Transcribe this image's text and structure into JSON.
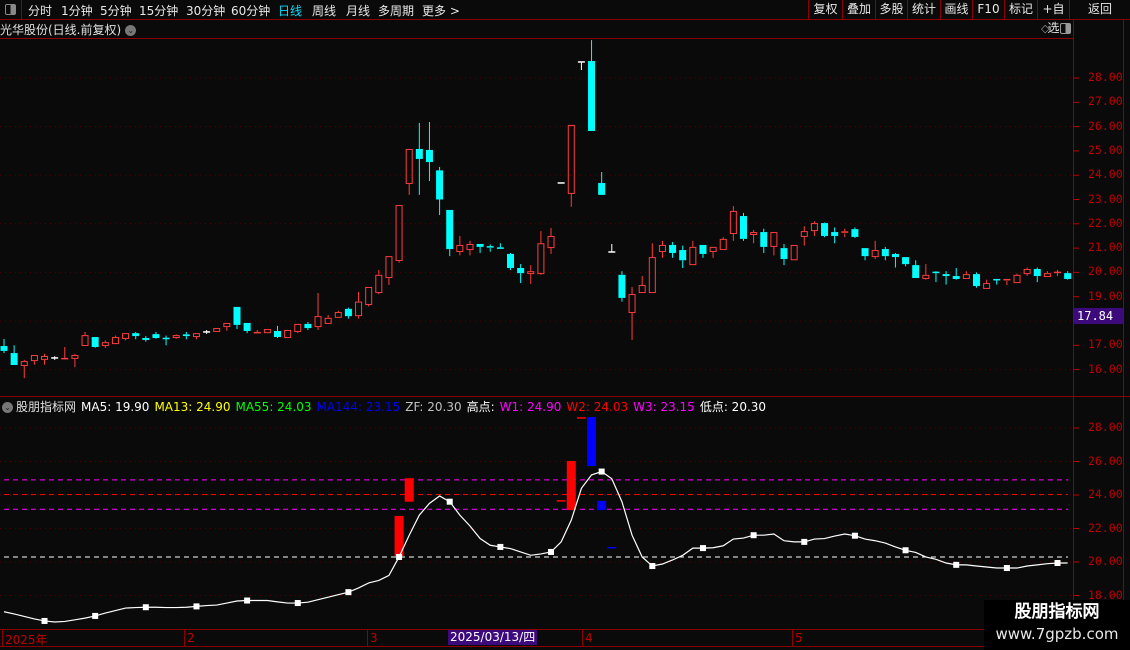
{
  "toolbar": {
    "periods": [
      "分时",
      "1分钟",
      "5分钟",
      "15分钟",
      "30分钟",
      "60分钟",
      "日线",
      "周线",
      "月线",
      "多周期",
      "更多 >"
    ],
    "active_period": "日线",
    "right_buttons": [
      "复权",
      "叠加",
      "多股",
      "统计",
      "画线",
      "F10",
      "标记",
      "+自选",
      "返回"
    ]
  },
  "chart_title": "光华股份(日线.前复权)",
  "price_axis": [
    "28.00",
    "27.00",
    "26.00",
    "25.00",
    "24.00",
    "23.00",
    "22.00",
    "21.00",
    "20.00",
    "19.00",
    "17.00",
    "16.00"
  ],
  "last_price": "17.84",
  "sub_axis": [
    "28.00",
    "26.00",
    "24.00",
    "22.00",
    "20.00",
    "18.00"
  ],
  "indicator": {
    "name": "股朋指标网",
    "items": [
      {
        "text": "MA5: 19.90",
        "color": "#ffffff"
      },
      {
        "text": "MA13: 24.90",
        "color": "#ffff00"
      },
      {
        "text": "MA55: 24.03",
        "color": "#00ff00"
      },
      {
        "text": "MA144: 23.15",
        "color": "#0000ff"
      },
      {
        "text": "ZF: 20.30",
        "color": "#c0c0c0"
      },
      {
        "text": "高点:",
        "color": "#ffffff"
      },
      {
        "text": "W1: 24.90",
        "color": "#ff00ff"
      },
      {
        "text": "W2: 24.03",
        "color": "#ff0000"
      },
      {
        "text": "W3: 23.15",
        "color": "#ff00ff"
      },
      {
        "text": "低点: 20.30",
        "color": "#ffffff"
      }
    ]
  },
  "x_axis": {
    "labels": [
      "2025年",
      "2",
      "3",
      "4",
      "5"
    ],
    "cursor_date": "2025/03/13/四"
  },
  "watermark": {
    "title": "股朋指标网",
    "url": "www.7gpzb.com"
  },
  "colors": {
    "up": "#ff3c3c",
    "down": "#00ffff",
    "doji": "#ffffff",
    "axis": "#c00000",
    "border": "#8b0000",
    "highlight": "#3c0a7a"
  },
  "chart_data": {
    "type": "candlestick",
    "ohlc_columns": [
      "open",
      "high",
      "low",
      "close"
    ],
    "candles": [
      [
        16.97,
        17.26,
        16.68,
        16.77
      ],
      [
        16.68,
        17.0,
        16.19,
        16.19
      ],
      [
        16.15,
        16.4,
        15.65,
        16.35
      ],
      [
        16.35,
        16.6,
        16.2,
        16.6
      ],
      [
        16.4,
        16.65,
        16.2,
        16.56
      ],
      [
        16.48,
        16.55,
        16.4,
        16.48
      ],
      [
        16.42,
        16.93,
        16.42,
        16.45
      ],
      [
        16.44,
        16.65,
        16.1,
        16.6
      ],
      [
        16.97,
        17.55,
        16.97,
        17.42
      ],
      [
        17.34,
        17.34,
        16.9,
        16.93
      ],
      [
        16.97,
        17.2,
        16.89,
        17.13
      ],
      [
        17.05,
        17.4,
        17.05,
        17.34
      ],
      [
        17.26,
        17.5,
        17.2,
        17.5
      ],
      [
        17.5,
        17.55,
        17.25,
        17.38
      ],
      [
        17.3,
        17.38,
        17.15,
        17.22
      ],
      [
        17.46,
        17.55,
        17.27,
        17.3
      ],
      [
        17.28,
        17.4,
        17.0,
        17.25
      ],
      [
        17.3,
        17.45,
        17.27,
        17.42
      ],
      [
        17.45,
        17.55,
        17.25,
        17.38
      ],
      [
        17.34,
        17.5,
        17.25,
        17.5
      ],
      [
        17.55,
        17.63,
        17.47,
        17.55
      ],
      [
        17.55,
        17.71,
        17.55,
        17.71
      ],
      [
        17.75,
        17.92,
        17.6,
        17.92
      ],
      [
        18.58,
        18.58,
        17.67,
        17.84
      ],
      [
        17.92,
        17.92,
        17.5,
        17.59
      ],
      [
        17.5,
        17.63,
        17.5,
        17.52
      ],
      [
        17.5,
        17.67,
        17.5,
        17.67
      ],
      [
        17.59,
        17.8,
        17.3,
        17.34
      ],
      [
        17.3,
        17.63,
        17.3,
        17.63
      ],
      [
        17.55,
        17.88,
        17.5,
        17.88
      ],
      [
        17.88,
        17.96,
        17.63,
        17.71
      ],
      [
        17.75,
        19.15,
        17.63,
        18.2
      ],
      [
        17.88,
        18.25,
        17.88,
        18.13
      ],
      [
        18.13,
        18.42,
        18.13,
        18.37
      ],
      [
        18.5,
        18.55,
        18.1,
        18.2
      ],
      [
        18.2,
        19.2,
        18.1,
        18.8
      ],
      [
        18.66,
        19.4,
        18.6,
        19.4
      ],
      [
        19.15,
        20.1,
        19.1,
        19.9
      ],
      [
        19.77,
        20.67,
        19.48,
        20.67
      ],
      [
        20.47,
        22.77,
        20.4,
        22.77
      ],
      [
        23.64,
        25.08,
        23.19,
        25.08
      ],
      [
        25.08,
        26.15,
        23.19,
        24.67
      ],
      [
        25.04,
        26.19,
        23.76,
        24.54
      ],
      [
        24.2,
        24.34,
        22.36,
        23.0
      ],
      [
        22.57,
        22.57,
        20.67,
        20.96
      ],
      [
        20.84,
        21.5,
        20.7,
        21.13
      ],
      [
        20.92,
        21.3,
        20.7,
        21.17
      ],
      [
        21.17,
        21.17,
        20.8,
        21.05
      ],
      [
        21.05,
        21.15,
        20.85,
        21.0
      ],
      [
        21.0,
        21.2,
        20.98,
        20.98
      ],
      [
        20.76,
        20.8,
        20.1,
        20.18
      ],
      [
        20.18,
        20.34,
        19.56,
        19.97
      ],
      [
        19.93,
        20.3,
        19.52,
        20.05
      ],
      [
        19.93,
        21.7,
        19.9,
        21.2
      ],
      [
        21.0,
        21.83,
        20.76,
        21.5
      ],
      [
        23.68,
        23.68,
        23.68,
        23.68
      ],
      [
        23.23,
        26.07,
        22.7,
        26.07
      ],
      [
        28.66,
        28.66,
        28.33,
        28.66
      ],
      [
        28.7,
        29.56,
        25.82,
        25.82
      ],
      [
        23.68,
        24.13,
        23.19,
        23.19
      ],
      [
        20.84,
        21.17,
        20.84,
        20.84
      ],
      [
        19.9,
        20.05,
        18.8,
        18.95
      ],
      [
        18.33,
        19.4,
        17.22,
        19.11
      ],
      [
        19.15,
        19.85,
        19.15,
        19.48
      ],
      [
        19.15,
        21.2,
        19.15,
        20.63
      ],
      [
        20.84,
        21.3,
        20.6,
        21.13
      ],
      [
        21.13,
        21.25,
        20.6,
        20.8
      ],
      [
        20.92,
        21.1,
        20.18,
        20.5
      ],
      [
        20.3,
        21.3,
        20.3,
        21.05
      ],
      [
        21.13,
        21.13,
        20.6,
        20.76
      ],
      [
        20.84,
        21.05,
        20.6,
        21.05
      ],
      [
        20.92,
        21.45,
        20.92,
        21.38
      ],
      [
        21.58,
        22.73,
        21.3,
        22.53
      ],
      [
        22.32,
        22.45,
        21.3,
        21.38
      ],
      [
        21.54,
        21.75,
        21.2,
        21.66
      ],
      [
        21.66,
        21.8,
        20.8,
        21.05
      ],
      [
        21.05,
        21.66,
        20.7,
        21.66
      ],
      [
        21.0,
        21.17,
        20.3,
        20.55
      ],
      [
        20.5,
        21.13,
        20.5,
        21.13
      ],
      [
        21.46,
        21.9,
        21.1,
        21.7
      ],
      [
        21.7,
        22.1,
        21.5,
        22.03
      ],
      [
        22.03,
        22.05,
        21.45,
        21.5
      ],
      [
        21.66,
        21.85,
        21.2,
        21.5
      ],
      [
        21.6,
        21.8,
        21.45,
        21.66
      ],
      [
        21.78,
        21.85,
        21.42,
        21.46
      ],
      [
        21.0,
        21.0,
        20.5,
        20.67
      ],
      [
        20.63,
        21.3,
        20.55,
        20.92
      ],
      [
        20.96,
        21.05,
        20.5,
        20.67
      ],
      [
        20.76,
        20.8,
        20.2,
        20.63
      ],
      [
        20.63,
        20.63,
        20.25,
        20.34
      ],
      [
        20.3,
        20.5,
        19.77,
        19.77
      ],
      [
        19.73,
        20.34,
        19.7,
        19.9
      ],
      [
        20.0,
        20.05,
        19.6,
        19.97
      ],
      [
        19.93,
        20.05,
        19.5,
        19.85
      ],
      [
        19.85,
        20.18,
        19.7,
        19.73
      ],
      [
        19.73,
        20.05,
        19.73,
        19.93
      ],
      [
        19.93,
        20.0,
        19.37,
        19.44
      ],
      [
        19.32,
        19.7,
        19.32,
        19.56
      ],
      [
        19.7,
        19.72,
        19.5,
        19.68
      ],
      [
        19.65,
        19.72,
        19.48,
        19.7
      ],
      [
        19.56,
        19.95,
        19.56,
        19.9
      ],
      [
        19.93,
        20.2,
        19.85,
        20.14
      ],
      [
        20.14,
        20.2,
        19.6,
        19.85
      ],
      [
        19.81,
        20.05,
        19.81,
        19.97
      ],
      [
        19.98,
        20.1,
        19.85,
        20.0
      ],
      [
        19.97,
        20.05,
        19.7,
        19.73
      ]
    ],
    "price_range": [
      15.4,
      29.6
    ],
    "grid": true,
    "sub_chart": {
      "range": [
        17.2,
        29.0
      ],
      "line": [
        17.03,
        16.9,
        16.75,
        16.6,
        16.48,
        16.42,
        16.45,
        16.55,
        16.65,
        16.78,
        16.95,
        17.1,
        17.25,
        17.28,
        17.3,
        17.3,
        17.28,
        17.28,
        17.3,
        17.35,
        17.4,
        17.43,
        17.55,
        17.67,
        17.7,
        17.7,
        17.7,
        17.62,
        17.55,
        17.55,
        17.6,
        17.75,
        17.9,
        18.05,
        18.2,
        18.45,
        18.75,
        18.9,
        19.2,
        20.3,
        21.6,
        22.8,
        23.5,
        23.94,
        23.6,
        22.8,
        22.15,
        21.4,
        21.0,
        20.9,
        20.8,
        20.6,
        20.4,
        20.48,
        20.6,
        21.2,
        22.5,
        24.4,
        25.2,
        25.4,
        24.97,
        23.6,
        21.6,
        20.3,
        19.76,
        19.88,
        20.12,
        20.4,
        20.83,
        20.83,
        20.85,
        20.97,
        21.37,
        21.43,
        21.6,
        21.6,
        21.67,
        21.27,
        21.2,
        21.2,
        21.37,
        21.4,
        21.55,
        21.67,
        21.57,
        21.37,
        21.27,
        21.13,
        20.9,
        20.7,
        20.57,
        20.3,
        20.16,
        19.94,
        19.83,
        19.83,
        19.76,
        19.7,
        19.64,
        19.64,
        19.64,
        19.76,
        19.83,
        19.9,
        19.94,
        19.94
      ],
      "levels": [
        {
          "value": 24.9,
          "color": "#ff00ff"
        },
        {
          "value": 24.03,
          "color": "#ff0000"
        },
        {
          "value": 23.15,
          "color": "#ff00ff"
        },
        {
          "value": 20.3,
          "color": "#ffffff"
        }
      ],
      "signal_bars": [
        {
          "index": 39,
          "from": 20.36,
          "to": 22.75,
          "color": "#ff0000"
        },
        {
          "index": 40,
          "from": 23.6,
          "to": 25.0,
          "color": "#ff0000"
        },
        {
          "index": 55,
          "from": 23.65,
          "to": 23.65,
          "color": "#ff0000"
        },
        {
          "index": 56,
          "from": 23.1,
          "to": 26.03,
          "color": "#ff0000"
        },
        {
          "index": 57,
          "from": 28.6,
          "to": 28.6,
          "color": "#ff0000"
        },
        {
          "index": 58,
          "from": 25.73,
          "to": 28.65,
          "color": "#0000ff"
        },
        {
          "index": 59,
          "from": 23.1,
          "to": 23.65,
          "color": "#0000ff"
        },
        {
          "index": 60,
          "from": 20.85,
          "to": 20.85,
          "color": "#0000ff"
        }
      ]
    }
  }
}
